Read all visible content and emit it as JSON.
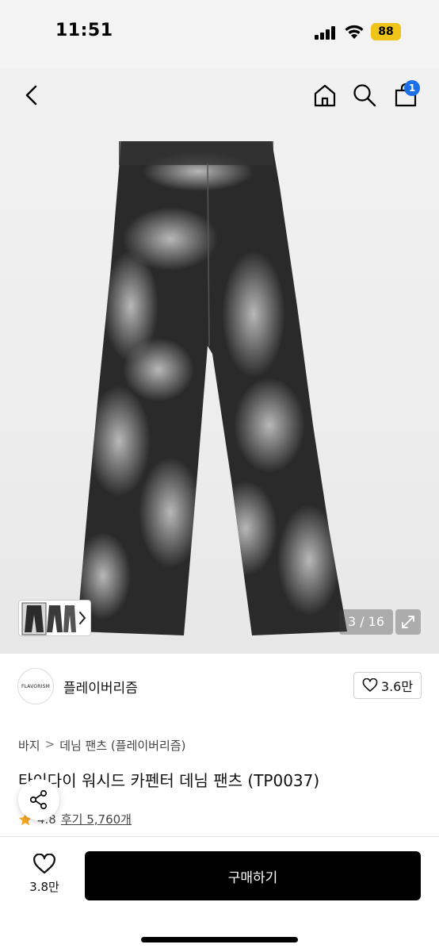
{
  "status_bar": {
    "time": "11:51",
    "battery": "88",
    "battery_color": "#f0c419"
  },
  "header": {
    "back_icon": "chevron-left-icon",
    "home_icon": "home-icon",
    "search_icon": "search-icon",
    "cart_icon": "shopping-bag-icon",
    "cart_count": "1",
    "badge_color": "#1d6fe8"
  },
  "gallery": {
    "page_counter": "3 / 16",
    "expand_icon": "expand-icon",
    "thumb_next_icon": "chevron-right-icon"
  },
  "brand": {
    "logo_text": "FLAVORISM",
    "name": "플레이버리즘",
    "likes": "3.6만"
  },
  "breadcrumb": {
    "category": "바지",
    "separator": ">",
    "subcategory": "데님 팬츠 (플레이버리즘)"
  },
  "product": {
    "title": "타이다이 워시드 카펜터 데님 팬츠 (TP0037)",
    "rating": "4.8",
    "reviews": "후기 5,760개",
    "star_color": "#f5a623"
  },
  "bottom_bar": {
    "wishlist_count": "3.8만",
    "buy_label": "구매하기"
  }
}
